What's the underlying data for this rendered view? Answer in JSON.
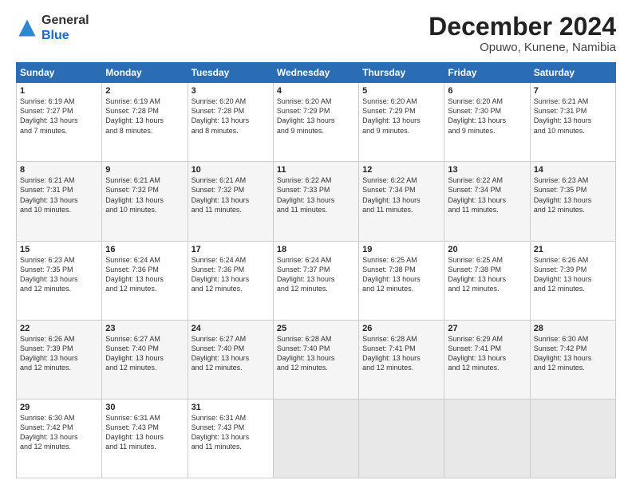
{
  "header": {
    "logo_general": "General",
    "logo_blue": "Blue",
    "month_title": "December 2024",
    "location": "Opuwo, Kunene, Namibia"
  },
  "weekdays": [
    "Sunday",
    "Monday",
    "Tuesday",
    "Wednesday",
    "Thursday",
    "Friday",
    "Saturday"
  ],
  "weeks": [
    [
      {
        "day": "1",
        "info": "Sunrise: 6:19 AM\nSunset: 7:27 PM\nDaylight: 13 hours\nand 7 minutes."
      },
      {
        "day": "2",
        "info": "Sunrise: 6:19 AM\nSunset: 7:28 PM\nDaylight: 13 hours\nand 8 minutes."
      },
      {
        "day": "3",
        "info": "Sunrise: 6:20 AM\nSunset: 7:28 PM\nDaylight: 13 hours\nand 8 minutes."
      },
      {
        "day": "4",
        "info": "Sunrise: 6:20 AM\nSunset: 7:29 PM\nDaylight: 13 hours\nand 9 minutes."
      },
      {
        "day": "5",
        "info": "Sunrise: 6:20 AM\nSunset: 7:29 PM\nDaylight: 13 hours\nand 9 minutes."
      },
      {
        "day": "6",
        "info": "Sunrise: 6:20 AM\nSunset: 7:30 PM\nDaylight: 13 hours\nand 9 minutes."
      },
      {
        "day": "7",
        "info": "Sunrise: 6:21 AM\nSunset: 7:31 PM\nDaylight: 13 hours\nand 10 minutes."
      }
    ],
    [
      {
        "day": "8",
        "info": "Sunrise: 6:21 AM\nSunset: 7:31 PM\nDaylight: 13 hours\nand 10 minutes."
      },
      {
        "day": "9",
        "info": "Sunrise: 6:21 AM\nSunset: 7:32 PM\nDaylight: 13 hours\nand 10 minutes."
      },
      {
        "day": "10",
        "info": "Sunrise: 6:21 AM\nSunset: 7:32 PM\nDaylight: 13 hours\nand 11 minutes."
      },
      {
        "day": "11",
        "info": "Sunrise: 6:22 AM\nSunset: 7:33 PM\nDaylight: 13 hours\nand 11 minutes."
      },
      {
        "day": "12",
        "info": "Sunrise: 6:22 AM\nSunset: 7:34 PM\nDaylight: 13 hours\nand 11 minutes."
      },
      {
        "day": "13",
        "info": "Sunrise: 6:22 AM\nSunset: 7:34 PM\nDaylight: 13 hours\nand 11 minutes."
      },
      {
        "day": "14",
        "info": "Sunrise: 6:23 AM\nSunset: 7:35 PM\nDaylight: 13 hours\nand 12 minutes."
      }
    ],
    [
      {
        "day": "15",
        "info": "Sunrise: 6:23 AM\nSunset: 7:35 PM\nDaylight: 13 hours\nand 12 minutes."
      },
      {
        "day": "16",
        "info": "Sunrise: 6:24 AM\nSunset: 7:36 PM\nDaylight: 13 hours\nand 12 minutes."
      },
      {
        "day": "17",
        "info": "Sunrise: 6:24 AM\nSunset: 7:36 PM\nDaylight: 13 hours\nand 12 minutes."
      },
      {
        "day": "18",
        "info": "Sunrise: 6:24 AM\nSunset: 7:37 PM\nDaylight: 13 hours\nand 12 minutes."
      },
      {
        "day": "19",
        "info": "Sunrise: 6:25 AM\nSunset: 7:38 PM\nDaylight: 13 hours\nand 12 minutes."
      },
      {
        "day": "20",
        "info": "Sunrise: 6:25 AM\nSunset: 7:38 PM\nDaylight: 13 hours\nand 12 minutes."
      },
      {
        "day": "21",
        "info": "Sunrise: 6:26 AM\nSunset: 7:39 PM\nDaylight: 13 hours\nand 12 minutes."
      }
    ],
    [
      {
        "day": "22",
        "info": "Sunrise: 6:26 AM\nSunset: 7:39 PM\nDaylight: 13 hours\nand 12 minutes."
      },
      {
        "day": "23",
        "info": "Sunrise: 6:27 AM\nSunset: 7:40 PM\nDaylight: 13 hours\nand 12 minutes."
      },
      {
        "day": "24",
        "info": "Sunrise: 6:27 AM\nSunset: 7:40 PM\nDaylight: 13 hours\nand 12 minutes."
      },
      {
        "day": "25",
        "info": "Sunrise: 6:28 AM\nSunset: 7:40 PM\nDaylight: 13 hours\nand 12 minutes."
      },
      {
        "day": "26",
        "info": "Sunrise: 6:28 AM\nSunset: 7:41 PM\nDaylight: 13 hours\nand 12 minutes."
      },
      {
        "day": "27",
        "info": "Sunrise: 6:29 AM\nSunset: 7:41 PM\nDaylight: 13 hours\nand 12 minutes."
      },
      {
        "day": "28",
        "info": "Sunrise: 6:30 AM\nSunset: 7:42 PM\nDaylight: 13 hours\nand 12 minutes."
      }
    ],
    [
      {
        "day": "29",
        "info": "Sunrise: 6:30 AM\nSunset: 7:42 PM\nDaylight: 13 hours\nand 12 minutes."
      },
      {
        "day": "30",
        "info": "Sunrise: 6:31 AM\nSunset: 7:43 PM\nDaylight: 13 hours\nand 11 minutes."
      },
      {
        "day": "31",
        "info": "Sunrise: 6:31 AM\nSunset: 7:43 PM\nDaylight: 13 hours\nand 11 minutes."
      },
      {
        "day": "",
        "info": ""
      },
      {
        "day": "",
        "info": ""
      },
      {
        "day": "",
        "info": ""
      },
      {
        "day": "",
        "info": ""
      }
    ]
  ]
}
